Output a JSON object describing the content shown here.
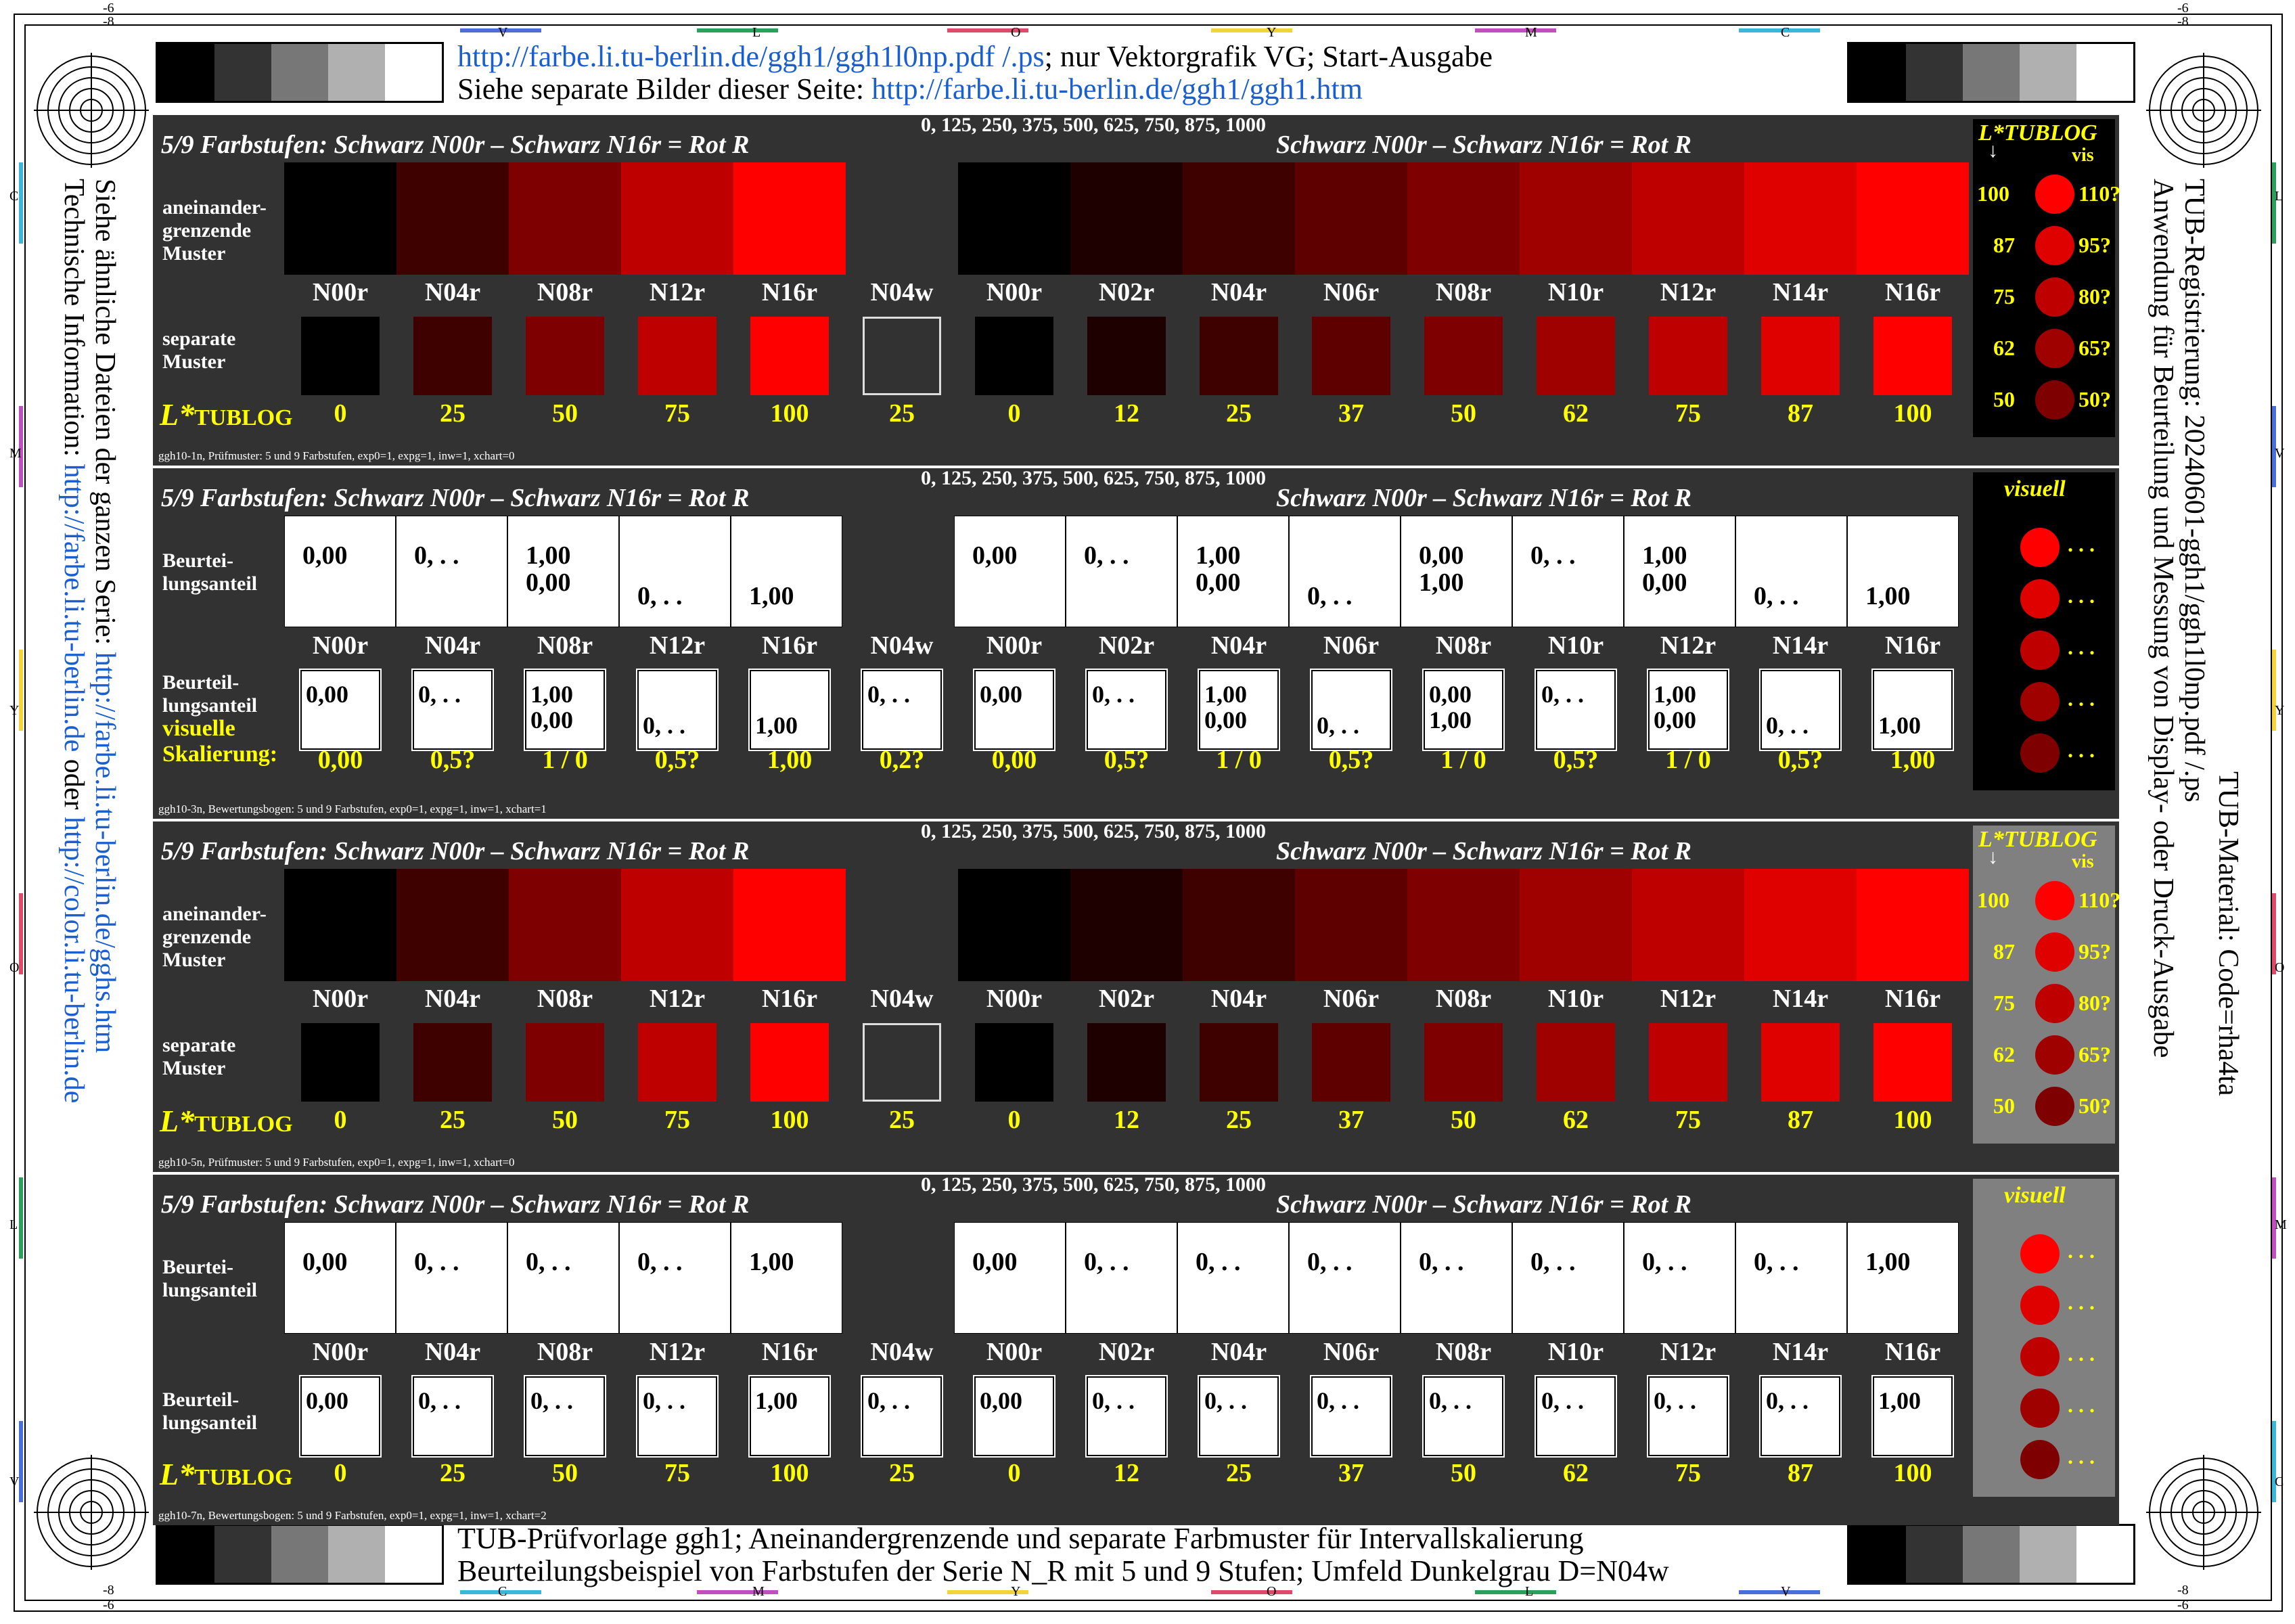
{
  "top_header": {
    "line1_link": "http://farbe.li.tu-berlin.de/ggh1/ggh1l0np.pdf /.ps",
    "line1_rest": "; nur Vektorgrafik VG; Start-Ausgabe",
    "line2_text": "Siehe separate Bilder dieser Seite: ",
    "line2_link": "http://farbe.li.tu-berlin.de/ggh1/ggh1.htm"
  },
  "bottom_header": {
    "line1": "TUB-Prüfvorlage ggh1; Aneinandergrenzende und separate Farbmuster für Intervallskalierung",
    "line2": "Beurteilungsbeispiel von Farbstufen der Serie N_R mit 5 und 9 Stufen; Umfeld Dunkelgrau D=N04w"
  },
  "left_side": {
    "line1_text": "Siehe ähnliche Dateien der ganzen Serie: ",
    "line1_link": "http://farbe.li.tu-berlin.de/gghs.htm",
    "line2_text": "Technische Information: ",
    "line2_link1": "http://farbe.li.tu-berlin.de",
    "line2_mid": " oder ",
    "line2_link2": "http://color.li.tu-berlin.de"
  },
  "right_side": {
    "line1": "TUB-Registrierung: 20240601-ggh1/ggh1l0np.pdf /.ps",
    "line2": "Anwendung für Beurteilung und Messung von Display- oder Druck-Ausgabe",
    "line3": "TUB-Material: Code=rha4ta"
  },
  "edge_labels": {
    "top": [
      "V",
      "L",
      "O",
      "Y",
      "M",
      "C"
    ],
    "bottom": [
      "C",
      "M",
      "Y",
      "O",
      "L",
      "V"
    ],
    "left": [
      "C",
      "M",
      "Y",
      "O",
      "L",
      "V"
    ],
    "right": [
      "L",
      "V",
      "Y",
      "O",
      "M",
      "C"
    ],
    "corner_tl": [
      "-6",
      "-8"
    ],
    "corner_tr": [
      "-6",
      "-8"
    ],
    "corner_bl": [
      "-8",
      "-6"
    ],
    "corner_br": [
      "-8",
      "-6"
    ]
  },
  "panel_common": {
    "title_left": "5/9 Farbstufen:  Schwarz N00r – Schwarz N16r = Rot R",
    "title_right": "Schwarz N00r – Schwarz N16r = Rot R",
    "sequence": "0, 125, 250, 375, 500, 625, 750, 875, 1000",
    "row_adjacent": "aneinander-\ngrenzende\nMuster",
    "row_separate": "separate\nMuster",
    "row_judgment": "Beurtei-\nlungsanteil",
    "row_judgment2": "Beurteil-\nlungsanteil",
    "visual_scaling": "visuelle",
    "scaling_label": "Skalierung:",
    "ltub_label": "L*",
    "ltub_sub": "TUBLOG",
    "labels": [
      "N00r",
      "N04r",
      "N08r",
      "N12r",
      "N16r",
      "N04w",
      "N00r",
      "N02r",
      "N04r",
      "N06r",
      "N08r",
      "N10r",
      "N12r",
      "N14r",
      "N16r"
    ],
    "lvalues": [
      "0",
      "25",
      "50",
      "75",
      "100",
      "25",
      "0",
      "12",
      "25",
      "37",
      "50",
      "62",
      "75",
      "87",
      "100"
    ],
    "colors": [
      "#000000",
      "#3f0000",
      "#7f0000",
      "#bf0000",
      "#ff0000",
      "#323232",
      "#000000",
      "#1f0000",
      "#3f0000",
      "#5f0000",
      "#7f0000",
      "#9f0000",
      "#bf0000",
      "#df0000",
      "#ff0000"
    ]
  },
  "panels": [
    {
      "note": "ggh10-1n, Prüfmuster: 5 und 9 Farbstufen, exp0=1, expg=1, inw=1, xchart=0"
    },
    {
      "note": "ggh10-3n, Bewertungsbogen: 5 und 9 Farbstufen, exp0=1, expg=1, inw=1, xchart=1",
      "scaling": [
        "0,00",
        "0,5?",
        "1 / 0",
        "0,5?",
        "1,00",
        "0,2?",
        "0,00",
        "0,5?",
        "1 / 0",
        "0,5?",
        "1 / 0",
        "0,5?",
        "1 / 0",
        "0,5?",
        "1,00"
      ]
    },
    {
      "note": "ggh10-5n, Prüfmuster: 5 und 9 Farbstufen, exp0=1, expg=1, inw=1, xchart=0"
    },
    {
      "note": "ggh10-7n, Bewertungsbogen: 5 und 9 Farbstufen, exp0=1, expg=1, inw=1, xchart=2"
    }
  ],
  "judg_panel2_big": [
    [
      "0,00"
    ],
    [
      "0, . ."
    ],
    [
      "1,00",
      "0,00"
    ],
    [
      "",
      "0, . ."
    ],
    [
      "",
      "1,00"
    ],
    null,
    [
      "0,00"
    ],
    [
      "0, . ."
    ],
    [
      "1,00",
      "0,00"
    ],
    [
      "",
      "0, . ."
    ],
    [
      "0,00",
      "1,00"
    ],
    [
      "0, . ."
    ],
    [
      "1,00",
      "0,00"
    ],
    [
      "",
      "0, . ."
    ],
    [
      "",
      "1,00"
    ]
  ],
  "judg_panel2_small": [
    [
      "0,00"
    ],
    [
      "0, . ."
    ],
    [
      "1,00",
      "0,00"
    ],
    [
      "",
      "0, . ."
    ],
    [
      "",
      "1,00"
    ],
    [
      "0, . ."
    ],
    [
      "0,00"
    ],
    [
      "0, . ."
    ],
    [
      "1,00",
      "0,00"
    ],
    [
      "",
      "0, . ."
    ],
    [
      "0,00",
      "1,00"
    ],
    [
      "0, . ."
    ],
    [
      "1,00",
      "0,00"
    ],
    [
      "",
      "0, . ."
    ],
    [
      "",
      "1,00"
    ]
  ],
  "judg_panel4_big": [
    [
      "0,00"
    ],
    [
      "0, . ."
    ],
    [
      "0, . ."
    ],
    [
      "0, . ."
    ],
    [
      "1,00"
    ],
    null,
    [
      "0,00"
    ],
    [
      "0, . ."
    ],
    [
      "0, . ."
    ],
    [
      "0, . ."
    ],
    [
      "0, . ."
    ],
    [
      "0, . ."
    ],
    [
      "0, . ."
    ],
    [
      "0, . ."
    ],
    [
      "1,00"
    ]
  ],
  "judg_panel4_small": [
    [
      "0,00"
    ],
    [
      "0, . ."
    ],
    [
      "0, . ."
    ],
    [
      "0, . ."
    ],
    [
      "1,00"
    ],
    [
      "0, . ."
    ],
    [
      "0,00"
    ],
    [
      "0, . ."
    ],
    [
      "0, . ."
    ],
    [
      "0, . ."
    ],
    [
      "0, . ."
    ],
    [
      "0, . ."
    ],
    [
      "0, . ."
    ],
    [
      "0, . ."
    ],
    [
      "1,00"
    ]
  ],
  "sidebox_tublog": {
    "title": "L*TUBLOG",
    "arrow": "↓",
    "vis": "vis",
    "left": [
      "100",
      "87",
      "75",
      "62",
      "50"
    ],
    "right": [
      "110?",
      "95?",
      "80?",
      "65?",
      "50?"
    ],
    "dot_colors": [
      "#ff0000",
      "#df0000",
      "#bf0000",
      "#9f0000",
      "#7f0000"
    ]
  },
  "sidebox_visual": {
    "title": "visuell",
    "dots": ". . .",
    "dot_colors": [
      "#ff0000",
      "#df0000",
      "#bf0000",
      "#9f0000",
      "#7f0000"
    ]
  },
  "colors": {
    "panel_bg": "#323232",
    "yellow": "#ffff00",
    "link": "#1a5fd0"
  }
}
